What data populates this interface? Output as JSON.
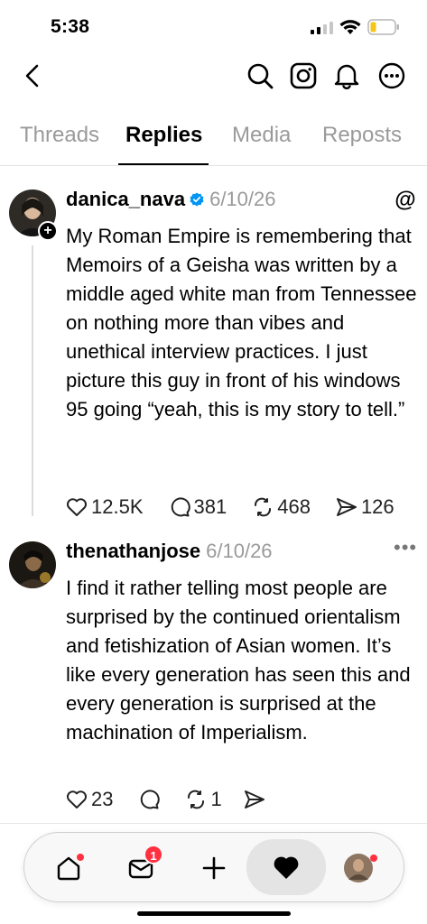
{
  "status_bar": {
    "time": "5:38"
  },
  "nav": {
    "back_icon": "chevron-left-icon",
    "search_icon": "search-icon",
    "instagram_icon": "instagram-icon",
    "notifications_icon": "bell-icon",
    "more_icon": "more-circle-icon"
  },
  "tabs": [
    {
      "label": "Threads",
      "active": false
    },
    {
      "label": "Replies",
      "active": true
    },
    {
      "label": "Media",
      "active": false
    },
    {
      "label": "Reposts",
      "active": false
    }
  ],
  "posts": [
    {
      "username": "danica_nava",
      "verified": true,
      "date": "6/10/26",
      "body": "My Roman Empire is remembering that Memoirs of a Geisha was written by a middle aged white man from Tennessee on nothing more than vibes and unethical interview practices. I just picture this guy in front of his windows 95 going “yeah, this is my story to tell.”",
      "likes": "12.5K",
      "comments": "381",
      "reposts": "468",
      "shares": "126",
      "corner_icon": "threads-logo-icon"
    },
    {
      "username": "thenathanjose",
      "verified": false,
      "date": "6/10/26",
      "body": "I find it rather telling most people are surprised by the continued orientalism and fetishization of Asian women. It’s like every generation has seen this and every generation is surprised at the machination of Imperialism.",
      "likes": "23",
      "comments": "",
      "reposts": "1",
      "shares": "",
      "corner_icon": "more-horizontal-icon"
    }
  ],
  "bottom_bar": {
    "items": [
      {
        "name": "home-icon",
        "dot": true
      },
      {
        "name": "inbox-icon",
        "badge": "1"
      },
      {
        "name": "plus-icon"
      },
      {
        "name": "heart-icon",
        "active": true
      },
      {
        "name": "profile-avatar",
        "dot": true
      }
    ]
  },
  "colors": {
    "accent_red": "#ff3040",
    "verified_blue": "#0095f6",
    "muted_text": "#9a9a9a"
  }
}
